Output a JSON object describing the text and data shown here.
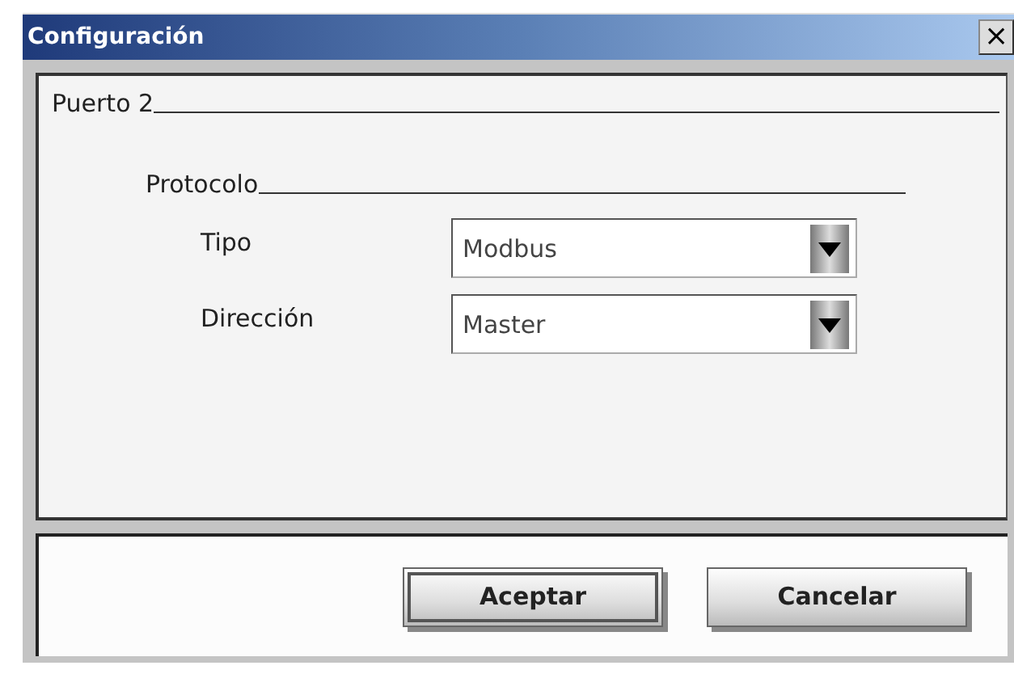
{
  "window": {
    "title": "Configuración",
    "close": "×"
  },
  "group": {
    "title": "Puerto 2"
  },
  "subgroup": {
    "title": "Protocolo"
  },
  "fields": [
    {
      "label": "Tipo",
      "value": "Modbus"
    },
    {
      "label": "Dirección",
      "value": "Master"
    }
  ],
  "buttons": [
    {
      "label": "Aceptar",
      "focused": true
    },
    {
      "label": "Cancelar",
      "focused": false
    }
  ]
}
